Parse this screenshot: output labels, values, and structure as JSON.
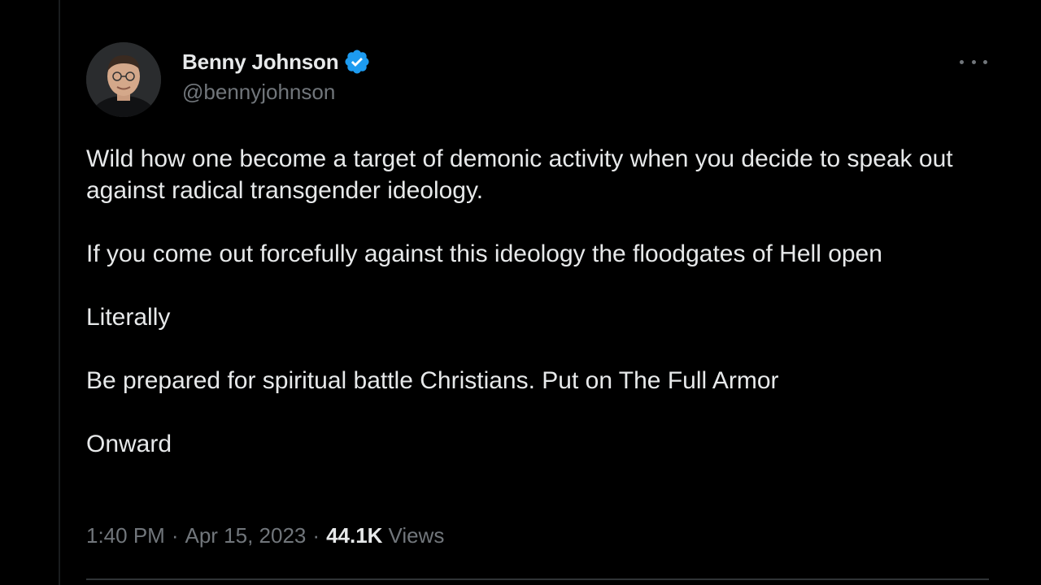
{
  "tweet": {
    "author": {
      "display_name": "Benny Johnson",
      "handle": "@bennyjohnson",
      "verified": true
    },
    "paragraphs": [
      "Wild how one become a target of demonic activity when you decide to speak out against radical transgender ideology.",
      "If you come out forcefully against this ideology the floodgates of Hell open",
      "Literally",
      "Be prepared for spiritual battle Christians. Put on The Full Armor",
      "Onward"
    ],
    "meta": {
      "time": "1:40 PM",
      "separator": "·",
      "date": "Apr 15, 2023",
      "views_count": "44.1K",
      "views_label": "Views"
    }
  },
  "colors": {
    "background": "#000000",
    "text_primary": "#e7e9ea",
    "text_secondary": "#71767b",
    "verified_blue": "#1d9bf0",
    "divider": "#2f3336"
  },
  "icons": {
    "verified": "verified-badge-icon",
    "more": "more-options-icon"
  }
}
